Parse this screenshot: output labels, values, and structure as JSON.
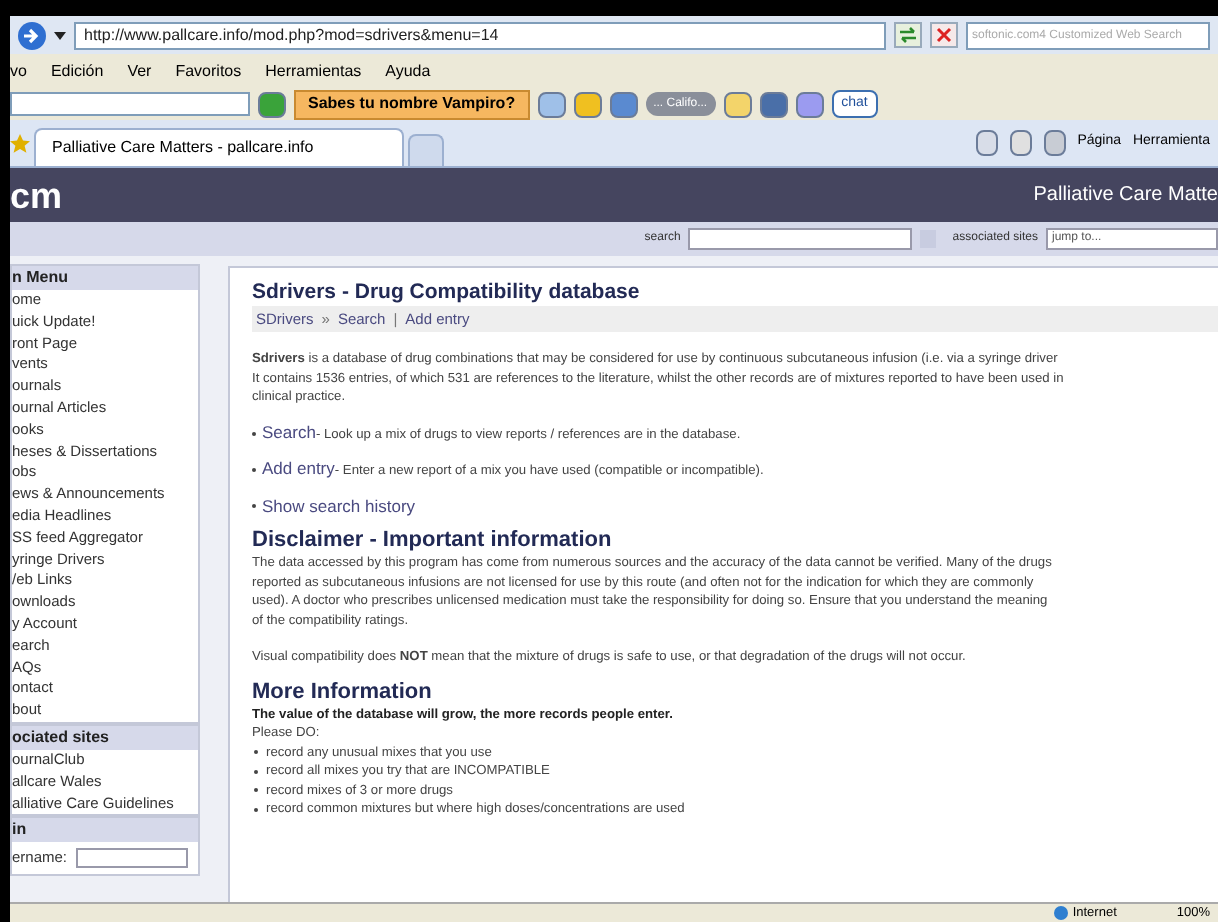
{
  "address_bar": {
    "url": "http://www.pallcare.info/mod.php?mod=sdrivers&menu=14",
    "search_placeholder": "softonic.com4 Customized Web Search"
  },
  "menu_bar": [
    "vo",
    "Edición",
    "Ver",
    "Favoritos",
    "Herramientas",
    "Ayuda"
  ],
  "toolbar": {
    "promo_button": "Sabes tu nombre Vampiro?",
    "player_label": "... Califo...",
    "chat_button": "chat"
  },
  "tabs": [
    {
      "label": "Palliative Care Matters - pallcare.info",
      "selected": true
    }
  ],
  "command_bar": [
    "Página",
    "Herramienta"
  ],
  "site": {
    "logo": "cm",
    "title": "Palliative Care Matte",
    "search_label": "search",
    "associated_label": "associated sites",
    "jump_placeholder": "jump to..."
  },
  "sidebar": [
    {
      "title": "n Menu",
      "items": [
        "ome",
        "uick Update!",
        "ront Page",
        "vents",
        "ournals",
        "ournal Articles",
        "ooks",
        "heses & Dissertations",
        "obs",
        "ews & Announcements",
        "edia Headlines",
        "SS feed Aggregator",
        "yringe Drivers",
        "/eb Links",
        "ownloads",
        "y Account",
        "earch",
        "AQs",
        "ontact",
        "bout"
      ]
    },
    {
      "title": "ociated sites",
      "items": [
        "ournalClub",
        "allcare Wales",
        "alliative Care Guidelines"
      ]
    },
    {
      "title": "in",
      "field_label": "ername:"
    }
  ],
  "content": {
    "title": "Sdrivers - Drug Compatibility database",
    "breadcrumb": [
      {
        "label": "SDrivers",
        "kind": "link"
      },
      {
        "label": "»",
        "kind": "sep"
      },
      {
        "label": "Search",
        "kind": "link"
      },
      {
        "label": "|",
        "kind": "sep"
      },
      {
        "label": "Add entry",
        "kind": "link"
      }
    ],
    "intro": [
      "**Sdrivers** is a database of drug combinations that may be considered for use by continuous subcutaneous infusion (i.e. via a syringe driver",
      "It contains 1536 entries, of which 531 are references to the literature, whilst the other records are of mixtures reported to have been used in",
      "clinical practice."
    ],
    "actions": [
      {
        "link": "Search",
        "text": " - Look up a mix of drugs to view reports / references are in the database."
      },
      {
        "link": "Add entry",
        "text": " - Enter a new report of a mix you have used (compatible or incompatible)."
      },
      {
        "link": "Show search history"
      }
    ],
    "disclaimer_title": "Disclaimer - Important information",
    "disclaimer": [
      "The data accessed by this program has come from numerous sources and the accuracy of the data cannot be verified. Many of the drugs",
      "reported as subcutaneous infusions are not licensed for use by this route (and often not for the indication for which they are commonly",
      "used). A doctor who prescribes unlicensed medication must take the responsibility for doing so. Ensure that you understand the meaning",
      "of the compatibility ratings."
    ],
    "visual_note": "Visual compatibility does **NOT** mean that the mixture of drugs is safe to use, or that degradation of the drugs will not occur.",
    "more_title": "More Information",
    "more_lead": "The value of the database will grow, the more records people enter.",
    "please_do": "Please DO:",
    "do_items": [
      "record any unusual mixes that you use",
      "record all mixes you try that are INCOMPATIBLE",
      "record mixes of 3 or more drugs",
      "record common mixtures but where high doses/concentrations are used"
    ]
  },
  "status_bar": {
    "zone": "Internet",
    "zoom": "100%"
  }
}
